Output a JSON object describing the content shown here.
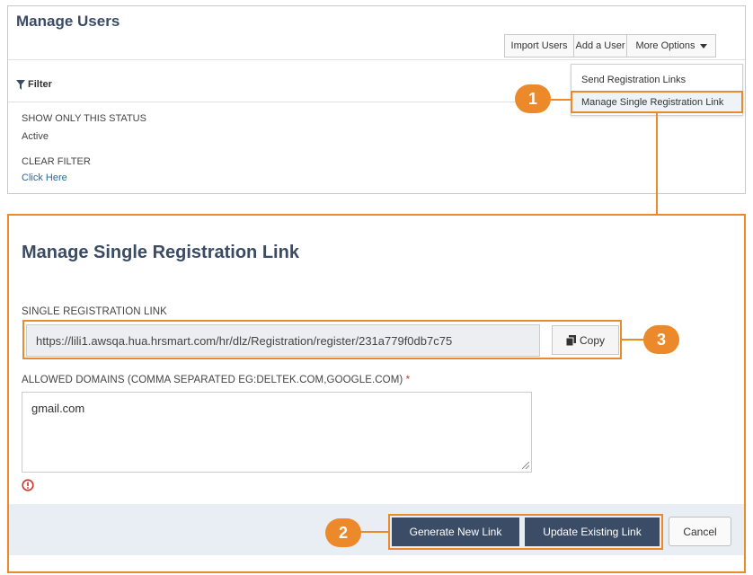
{
  "top": {
    "title": "Manage Users",
    "buttons": {
      "import": "Import Users",
      "add": "Add a User",
      "more": "More Options"
    },
    "filter": {
      "label": "Filter",
      "status_heading": "SHOW ONLY THIS STATUS",
      "status_value": "Active",
      "clear_heading": "CLEAR FILTER",
      "clear_link": "Click Here"
    },
    "dropdown": {
      "items": [
        "Send Registration Links",
        "Manage Single Registration Link"
      ]
    }
  },
  "callouts": [
    "1",
    "2",
    "3"
  ],
  "dialog": {
    "title": "Manage Single Registration Link",
    "link_label": "SINGLE REGISTRATION LINK",
    "link_value": "https://lili1.awsqa.hua.hrsmart.com/hr/dlz/Registration/register/231a779f0db7c75",
    "copy_label": "Copy",
    "domains_label": "ALLOWED DOMAINS (COMMA SEPARATED EG:DELTEK.COM,GOOGLE.COM)",
    "required_mark": "*",
    "domains_value": "gmail.com",
    "buttons": {
      "generate": "Generate New Link",
      "update": "Update Existing Link",
      "cancel": "Cancel"
    }
  },
  "colors": {
    "accent_orange": "#ec8a2b",
    "primary_dark": "#3b4c66",
    "link_blue": "#2469a8",
    "error_red": "#d0342c"
  },
  "icons": [
    "funnel-icon",
    "caret-down-icon",
    "copy-icon",
    "error-icon",
    "resize-handle-icon"
  ]
}
